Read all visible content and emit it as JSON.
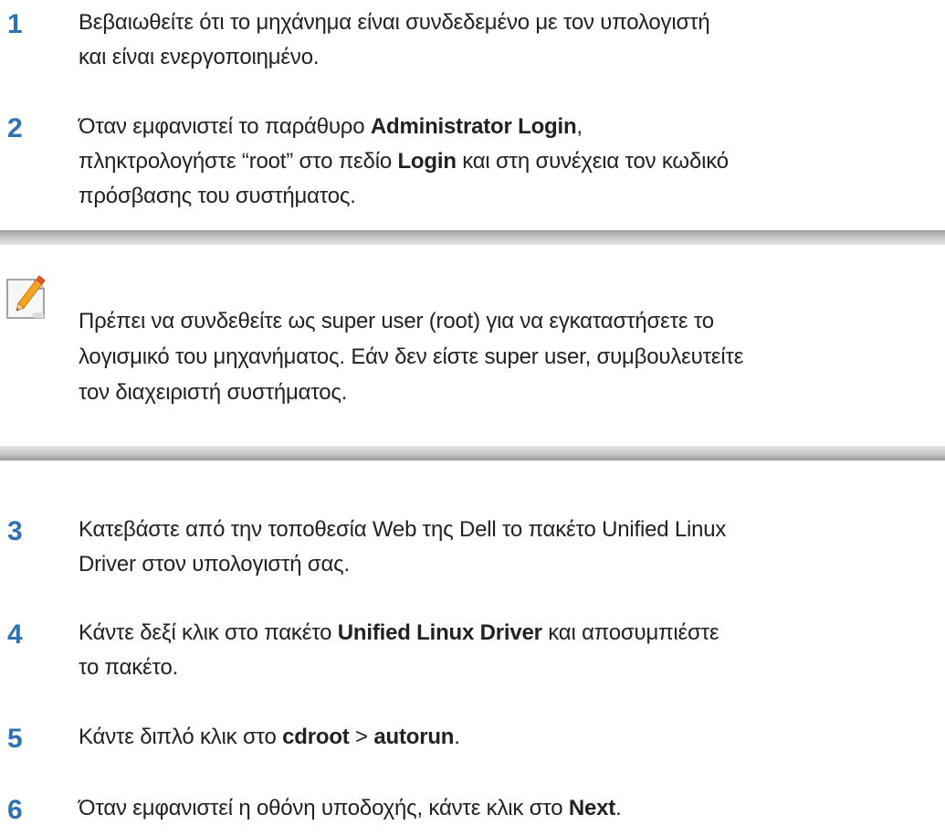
{
  "steps": [
    {
      "number": "1",
      "lines": [
        [
          {
            "t": "Βεβαιωθείτε ότι το μηχάνημα είναι συνδεδεμένο με τον υπολογιστή",
            "b": false
          }
        ],
        [
          {
            "t": "και είναι ενεργοποιημένο.",
            "b": false
          }
        ]
      ]
    },
    {
      "number": "2",
      "lines": [
        [
          {
            "t": "Όταν εμφανιστεί το παράθυρο ",
            "b": false
          },
          {
            "t": "Administrator Login",
            "b": true
          },
          {
            "t": ",",
            "b": false
          }
        ],
        [
          {
            "t": "πληκτρολογήστε “root” στο πεδίο ",
            "b": false
          },
          {
            "t": "Login",
            "b": true
          },
          {
            "t": " και στη συνέχεια τον κωδικό",
            "b": false
          }
        ],
        [
          {
            "t": "πρόσβασης του συστήματος.",
            "b": false
          }
        ]
      ]
    },
    {
      "number": "3",
      "lines": [
        [
          {
            "t": "Κατεβάστε από την τοποθεσία Web της Dell το πακέτο Unified Linux",
            "b": false
          }
        ],
        [
          {
            "t": "Driver στον υπολογιστή σας.",
            "b": false
          }
        ]
      ]
    },
    {
      "number": "4",
      "lines": [
        [
          {
            "t": "Κάντε δεξί κλικ στο πακέτο ",
            "b": false
          },
          {
            "t": "Unified Linux Driver",
            "b": true
          },
          {
            "t": " και αποσυμπιέστε",
            "b": false
          }
        ],
        [
          {
            "t": "το πακέτο.",
            "b": false
          }
        ]
      ]
    },
    {
      "number": "5",
      "lines": [
        [
          {
            "t": "Κάντε διπλό κλικ στο ",
            "b": false
          },
          {
            "t": "cdroot",
            "b": true
          },
          {
            "t": " > ",
            "b": false
          },
          {
            "t": "autorun",
            "b": true
          },
          {
            "t": ".",
            "b": false
          }
        ]
      ]
    },
    {
      "number": "6",
      "lines": [
        [
          {
            "t": "Όταν εμφανιστεί η οθόνη υποδοχής, κάντε κλικ στο ",
            "b": false
          },
          {
            "t": "Next",
            "b": true
          },
          {
            "t": ".",
            "b": false
          }
        ]
      ]
    }
  ],
  "note": {
    "icon": "note-pencil-icon",
    "lines": [
      "Πρέπει να συνδεθείτε ως super user (root) για να εγκαταστήσετε το",
      "λογισμικό του μηχανήματος. Εάν δεν είστε super user, συμβουλευτείτε",
      "τον διαχειριστή συστήματος."
    ]
  },
  "colors": {
    "step_number": "#2f72b4",
    "text": "#222222",
    "note_bar": "#c4c4c4"
  }
}
